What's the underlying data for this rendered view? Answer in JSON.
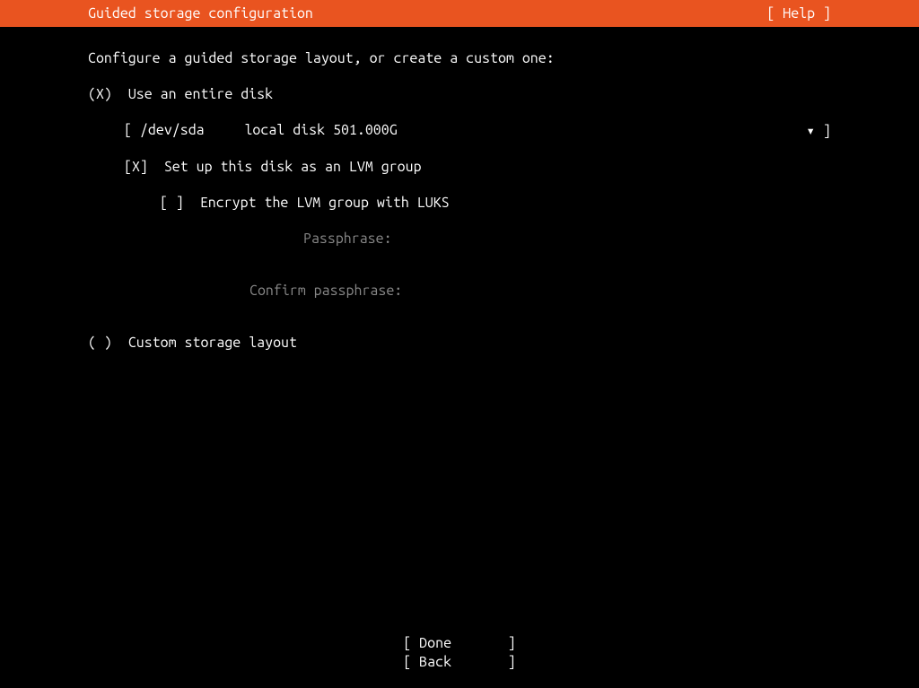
{
  "header": {
    "title": "Guided storage configuration",
    "help": "[ Help ]"
  },
  "prompt": "Configure a guided storage layout, or create a custom one:",
  "options": {
    "use_entire_disk": {
      "marker": "(X)",
      "label": "Use an entire disk"
    },
    "disk_selector": {
      "open": "[",
      "device": "/dev/sda",
      "description": "local disk 501.000G",
      "close": "]"
    },
    "lvm": {
      "marker": "[X]",
      "label": "Set up this disk as an LVM group"
    },
    "encrypt": {
      "marker": "[ ]",
      "label": "Encrypt the LVM group with LUKS"
    },
    "passphrase_label": "Passphrase:",
    "confirm_passphrase_label": "Confirm passphrase:",
    "custom": {
      "marker": "( )",
      "label": "Custom storage layout"
    }
  },
  "footer": {
    "done": "[ Done       ]",
    "back": "[ Back       ]"
  }
}
